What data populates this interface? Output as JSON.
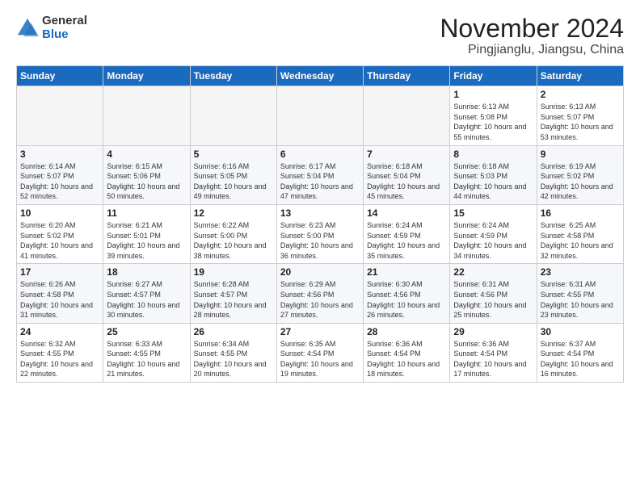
{
  "logo": {
    "general": "General",
    "blue": "Blue"
  },
  "title": "November 2024",
  "subtitle": "Pingjianglu, Jiangsu, China",
  "days_of_week": [
    "Sunday",
    "Monday",
    "Tuesday",
    "Wednesday",
    "Thursday",
    "Friday",
    "Saturday"
  ],
  "weeks": [
    [
      {
        "day": "",
        "sunrise": "",
        "sunset": "",
        "daylight": ""
      },
      {
        "day": "",
        "sunrise": "",
        "sunset": "",
        "daylight": ""
      },
      {
        "day": "",
        "sunrise": "",
        "sunset": "",
        "daylight": ""
      },
      {
        "day": "",
        "sunrise": "",
        "sunset": "",
        "daylight": ""
      },
      {
        "day": "",
        "sunrise": "",
        "sunset": "",
        "daylight": ""
      },
      {
        "day": "1",
        "sunrise": "Sunrise: 6:13 AM",
        "sunset": "Sunset: 5:08 PM",
        "daylight": "Daylight: 10 hours and 55 minutes."
      },
      {
        "day": "2",
        "sunrise": "Sunrise: 6:13 AM",
        "sunset": "Sunset: 5:07 PM",
        "daylight": "Daylight: 10 hours and 53 minutes."
      }
    ],
    [
      {
        "day": "3",
        "sunrise": "Sunrise: 6:14 AM",
        "sunset": "Sunset: 5:07 PM",
        "daylight": "Daylight: 10 hours and 52 minutes."
      },
      {
        "day": "4",
        "sunrise": "Sunrise: 6:15 AM",
        "sunset": "Sunset: 5:06 PM",
        "daylight": "Daylight: 10 hours and 50 minutes."
      },
      {
        "day": "5",
        "sunrise": "Sunrise: 6:16 AM",
        "sunset": "Sunset: 5:05 PM",
        "daylight": "Daylight: 10 hours and 49 minutes."
      },
      {
        "day": "6",
        "sunrise": "Sunrise: 6:17 AM",
        "sunset": "Sunset: 5:04 PM",
        "daylight": "Daylight: 10 hours and 47 minutes."
      },
      {
        "day": "7",
        "sunrise": "Sunrise: 6:18 AM",
        "sunset": "Sunset: 5:04 PM",
        "daylight": "Daylight: 10 hours and 45 minutes."
      },
      {
        "day": "8",
        "sunrise": "Sunrise: 6:18 AM",
        "sunset": "Sunset: 5:03 PM",
        "daylight": "Daylight: 10 hours and 44 minutes."
      },
      {
        "day": "9",
        "sunrise": "Sunrise: 6:19 AM",
        "sunset": "Sunset: 5:02 PM",
        "daylight": "Daylight: 10 hours and 42 minutes."
      }
    ],
    [
      {
        "day": "10",
        "sunrise": "Sunrise: 6:20 AM",
        "sunset": "Sunset: 5:02 PM",
        "daylight": "Daylight: 10 hours and 41 minutes."
      },
      {
        "day": "11",
        "sunrise": "Sunrise: 6:21 AM",
        "sunset": "Sunset: 5:01 PM",
        "daylight": "Daylight: 10 hours and 39 minutes."
      },
      {
        "day": "12",
        "sunrise": "Sunrise: 6:22 AM",
        "sunset": "Sunset: 5:00 PM",
        "daylight": "Daylight: 10 hours and 38 minutes."
      },
      {
        "day": "13",
        "sunrise": "Sunrise: 6:23 AM",
        "sunset": "Sunset: 5:00 PM",
        "daylight": "Daylight: 10 hours and 36 minutes."
      },
      {
        "day": "14",
        "sunrise": "Sunrise: 6:24 AM",
        "sunset": "Sunset: 4:59 PM",
        "daylight": "Daylight: 10 hours and 35 minutes."
      },
      {
        "day": "15",
        "sunrise": "Sunrise: 6:24 AM",
        "sunset": "Sunset: 4:59 PM",
        "daylight": "Daylight: 10 hours and 34 minutes."
      },
      {
        "day": "16",
        "sunrise": "Sunrise: 6:25 AM",
        "sunset": "Sunset: 4:58 PM",
        "daylight": "Daylight: 10 hours and 32 minutes."
      }
    ],
    [
      {
        "day": "17",
        "sunrise": "Sunrise: 6:26 AM",
        "sunset": "Sunset: 4:58 PM",
        "daylight": "Daylight: 10 hours and 31 minutes."
      },
      {
        "day": "18",
        "sunrise": "Sunrise: 6:27 AM",
        "sunset": "Sunset: 4:57 PM",
        "daylight": "Daylight: 10 hours and 30 minutes."
      },
      {
        "day": "19",
        "sunrise": "Sunrise: 6:28 AM",
        "sunset": "Sunset: 4:57 PM",
        "daylight": "Daylight: 10 hours and 28 minutes."
      },
      {
        "day": "20",
        "sunrise": "Sunrise: 6:29 AM",
        "sunset": "Sunset: 4:56 PM",
        "daylight": "Daylight: 10 hours and 27 minutes."
      },
      {
        "day": "21",
        "sunrise": "Sunrise: 6:30 AM",
        "sunset": "Sunset: 4:56 PM",
        "daylight": "Daylight: 10 hours and 26 minutes."
      },
      {
        "day": "22",
        "sunrise": "Sunrise: 6:31 AM",
        "sunset": "Sunset: 4:56 PM",
        "daylight": "Daylight: 10 hours and 25 minutes."
      },
      {
        "day": "23",
        "sunrise": "Sunrise: 6:31 AM",
        "sunset": "Sunset: 4:55 PM",
        "daylight": "Daylight: 10 hours and 23 minutes."
      }
    ],
    [
      {
        "day": "24",
        "sunrise": "Sunrise: 6:32 AM",
        "sunset": "Sunset: 4:55 PM",
        "daylight": "Daylight: 10 hours and 22 minutes."
      },
      {
        "day": "25",
        "sunrise": "Sunrise: 6:33 AM",
        "sunset": "Sunset: 4:55 PM",
        "daylight": "Daylight: 10 hours and 21 minutes."
      },
      {
        "day": "26",
        "sunrise": "Sunrise: 6:34 AM",
        "sunset": "Sunset: 4:55 PM",
        "daylight": "Daylight: 10 hours and 20 minutes."
      },
      {
        "day": "27",
        "sunrise": "Sunrise: 6:35 AM",
        "sunset": "Sunset: 4:54 PM",
        "daylight": "Daylight: 10 hours and 19 minutes."
      },
      {
        "day": "28",
        "sunrise": "Sunrise: 6:36 AM",
        "sunset": "Sunset: 4:54 PM",
        "daylight": "Daylight: 10 hours and 18 minutes."
      },
      {
        "day": "29",
        "sunrise": "Sunrise: 6:36 AM",
        "sunset": "Sunset: 4:54 PM",
        "daylight": "Daylight: 10 hours and 17 minutes."
      },
      {
        "day": "30",
        "sunrise": "Sunrise: 6:37 AM",
        "sunset": "Sunset: 4:54 PM",
        "daylight": "Daylight: 10 hours and 16 minutes."
      }
    ]
  ]
}
